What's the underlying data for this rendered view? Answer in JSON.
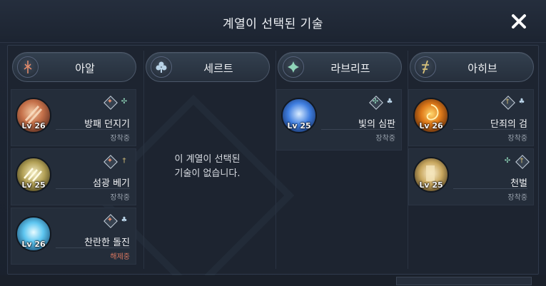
{
  "dialog": {
    "title": "계열이 선택된 기술",
    "close_icon": "close-icon"
  },
  "colors": {
    "panel_bg": "#1d2430",
    "card_bg": "#242d3a",
    "status_equipped": "#9aa3ae",
    "status_unequipped": "#d9765f"
  },
  "columns": [
    {
      "label": "아알",
      "icon": "aal-emblem-icon",
      "skills": [
        {
          "name": "방패 던지기",
          "level": "Lv 26",
          "status": "장착중",
          "icon": "shield-throw-icon",
          "tags": [
            "diamond-emblem",
            "leaf-glyph"
          ]
        },
        {
          "name": "섬광 베기",
          "level": "Lv 25",
          "status": "장착중",
          "icon": "flash-slash-icon",
          "tags": [
            "diamond-emblem",
            "dagger-glyph"
          ]
        },
        {
          "name": "찬란한 돌진",
          "level": "Lv 26",
          "status": "해제중",
          "icon": "brilliant-charge-icon",
          "tags": [
            "diamond-emblem",
            "fleur-glyph"
          ]
        }
      ]
    },
    {
      "label": "세르트",
      "icon": "sert-emblem-icon",
      "skills": [],
      "empty_message": "이 계열이 선택된\n기술이 없습니다."
    },
    {
      "label": "라브리프",
      "icon": "labrief-emblem-icon",
      "skills": [
        {
          "name": "빛의 심판",
          "level": "Lv 25",
          "status": "장착중",
          "icon": "judgement-of-light-icon",
          "tags": [
            "diamond-emblem",
            "fleur-glyph"
          ]
        }
      ]
    },
    {
      "label": "아히브",
      "icon": "ahib-emblem-icon",
      "skills": [
        {
          "name": "단죄의 검",
          "level": "Lv 26",
          "status": "장착중",
          "icon": "condemnation-sword-icon",
          "tags": [
            "diamond-emblem",
            "fleur-glyph"
          ]
        },
        {
          "name": "천벌",
          "level": "Lv 25",
          "status": "장착중",
          "icon": "divine-punishment-icon",
          "tags": [
            "leaf-glyph",
            "diamond-emblem"
          ]
        }
      ]
    }
  ]
}
